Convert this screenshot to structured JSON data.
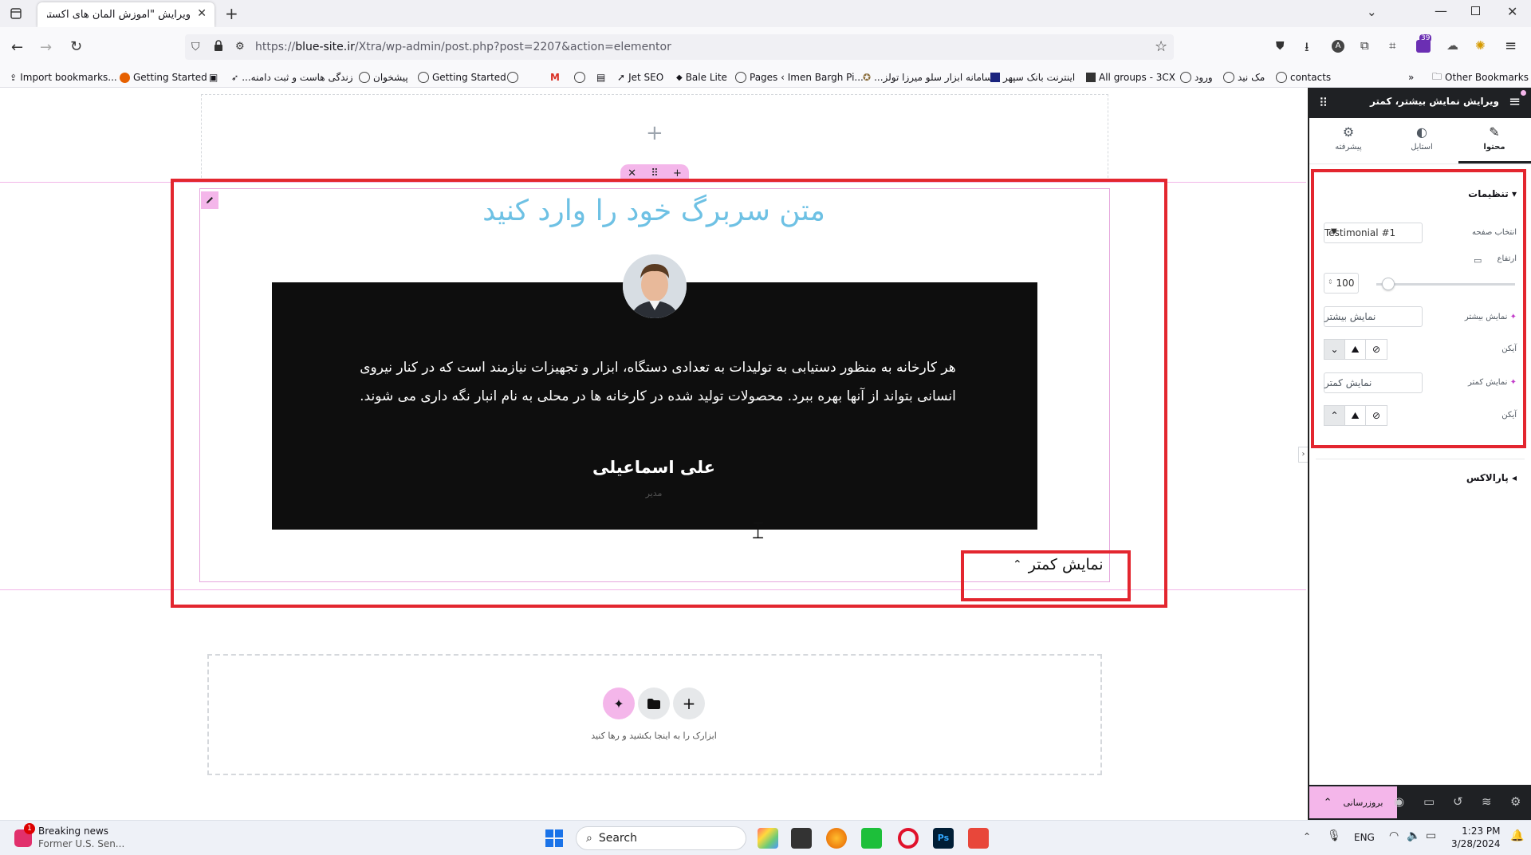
{
  "browser": {
    "tab_title": "ویرایش \"آموزش المان های اکسترا – ...",
    "url_prefix": "https://",
    "url_host": "blue-site.ir",
    "url_path": "/Xtra/wp-admin/post.php?post=2207&action=elementor",
    "extension_badge": "39",
    "bookmarks": [
      "Import bookmarks...",
      "Getting Started",
      "...زندگی هاست و ثبت دامنه",
      "پیشخوان",
      "Getting Started",
      "Jet SEO",
      "Bale Lite",
      "Pages ‹ Imen Bargh Pi...",
      "...سامانه ابزار سلو میرزا تولز",
      "اینترنت بانک سپهر",
      "All groups - 3CX",
      "ورود",
      "مک نید",
      "contacts"
    ],
    "other_bookmarks": "Other Bookmarks"
  },
  "canvas": {
    "heading": "متن سربرگ خود را وارد کنید",
    "quote": "هر کارخانه به منظور دستیابی به تولیدات به تعدادی دستگاه، ابزار و تجهیزات نیازمند است که در کنار نیروی انسانی بتواند از آنها بهره ببرد. محصولات تولید شده در کارخانه ها در محلی به نام انبار نگه داری می شوند.",
    "author": "علی اسماعیلی",
    "role": "مدیر",
    "show_less_button": "نمایش کمتر",
    "drop_hint": "ابزارک را به اینجا بکشید و رها کنید"
  },
  "panel": {
    "title": "ویرایش نمایش بیشتر، کمتر",
    "tabs": [
      {
        "label": "محتوا",
        "icon": "pencil-icon"
      },
      {
        "label": "استایل",
        "icon": "contrast-icon"
      },
      {
        "label": "پیشرفته",
        "icon": "gear-icon"
      }
    ],
    "section_settings": "تنظیمات",
    "select_page_label": "انتخاب صفحه",
    "select_page_value": "Testimonial #1",
    "height_label": "ارتفاع",
    "height_value": "100",
    "height_fraction": 0.05,
    "show_more_label": "نمایش بیشتر",
    "show_more_value": "نمایش بیشتر",
    "icon_label": "آیکن",
    "show_less_label": "نمایش کمتر",
    "show_less_value": "نمایش کمتر",
    "icon2_label": "آیکن",
    "section_parallax": "پارالاکس",
    "publish_label": "بروزرسانی"
  },
  "taskbar": {
    "news_title": "Breaking news",
    "news_sub": "Former U.S. Sen...",
    "news_badge": "1",
    "search_label": "Search",
    "lang": "ENG",
    "time": "1:23 PM",
    "date": "3/28/2024"
  }
}
